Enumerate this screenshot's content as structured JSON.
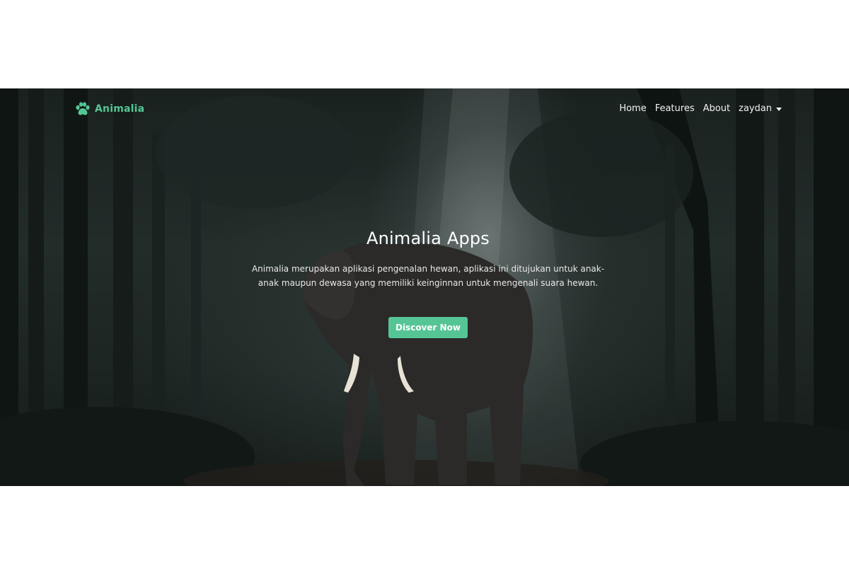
{
  "navbar": {
    "brand": "Animalia",
    "brand_icon": "paw-icon",
    "links": {
      "home": "Home",
      "features": "Features",
      "about": "About"
    },
    "user_menu": "zaydan"
  },
  "hero": {
    "title": "Animalia Apps",
    "description": "Animalia merupakan aplikasi pengenalan hewan, aplikasi ini ditujukan untuk anak-anak maupun dewasa yang memiliki keinginnan untuk mengenali suara hewan.",
    "cta_label": "Discover Now",
    "background_image": "elephant in misty forest"
  },
  "colors": {
    "accent": "#55c596",
    "nav_text": "#f2f2f2",
    "hero_overlay": "#1c2522"
  }
}
